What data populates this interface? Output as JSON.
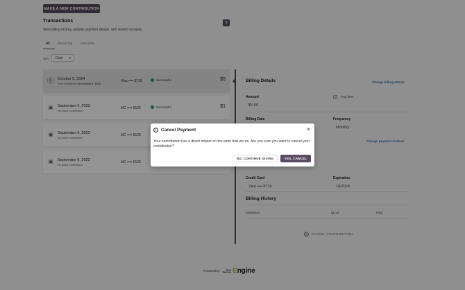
{
  "header": {
    "new_button": "MAKE A NEW CONTRIBUTION",
    "title": "Transactions",
    "subtitle": "View billing history, update payment details, and resend receipts.",
    "help": "?"
  },
  "tabs": [
    {
      "label": "All",
      "active": true
    },
    {
      "label": "Recurring",
      "active": false
    },
    {
      "label": "One-time",
      "active": false
    }
  ],
  "sort": {
    "label": "Sort",
    "value": "Date"
  },
  "transactions": [
    {
      "icon": "recurring-icon",
      "date": "October 9, 2024",
      "sub_prefix": "Next contribution",
      "sub_date": "November 9, 2024",
      "card": "Visa •••• 8719",
      "status": "Successful",
      "amount": "$5"
    },
    {
      "icon": "calendar-icon",
      "date": "September 6, 2023",
      "sub": "No future contribution",
      "card": "MC •••• 5528",
      "status": "Successful",
      "amount": "$1"
    },
    {
      "icon": "calendar-icon",
      "date": "September 6, 2023",
      "sub": "No future contribution",
      "card": "MC •••• 5528"
    },
    {
      "icon": "calendar-icon",
      "date": "September 6, 2023",
      "sub": "No future contribution",
      "card": "MC •••• 5528"
    }
  ],
  "details": {
    "title": "Billing Details",
    "change_billing": "Change billing details",
    "amount_label": "Amount",
    "amount_value": "$5.00",
    "pay_fees_label": "Pay fees",
    "billing_date_label": "Billing Date",
    "frequency_label": "Frequency",
    "frequency_value": "Monthly",
    "change_payment": "Change payment method",
    "credit_card_label": "Credit Card",
    "credit_card_value": "Visa •••• 8719",
    "expiration_label": "Expiration",
    "expiration_value": "10/2028",
    "history_title": "Billing History",
    "history": [
      {
        "date": "10/9/2024",
        "amount": "$1.33",
        "status": "Paid"
      }
    ],
    "cancel_label": "CANCEL CONTRIBUTION"
  },
  "footer": {
    "powered_by": "Powered by",
    "logo_line1": "News",
    "logo_line2": "Revenue",
    "logo_engine": "Engine"
  },
  "modal": {
    "title": "Cancel Payment",
    "body": "Your contribution has a direct impact on the work that we do. Are you sure you want to cancel your contribution?",
    "secondary_button": "NO, CONTINUE GIVING",
    "primary_button": "YES, CANCEL"
  },
  "colors": {
    "accent": "#5b4b63",
    "success": "#1aa35a",
    "link": "#2f74b5"
  }
}
